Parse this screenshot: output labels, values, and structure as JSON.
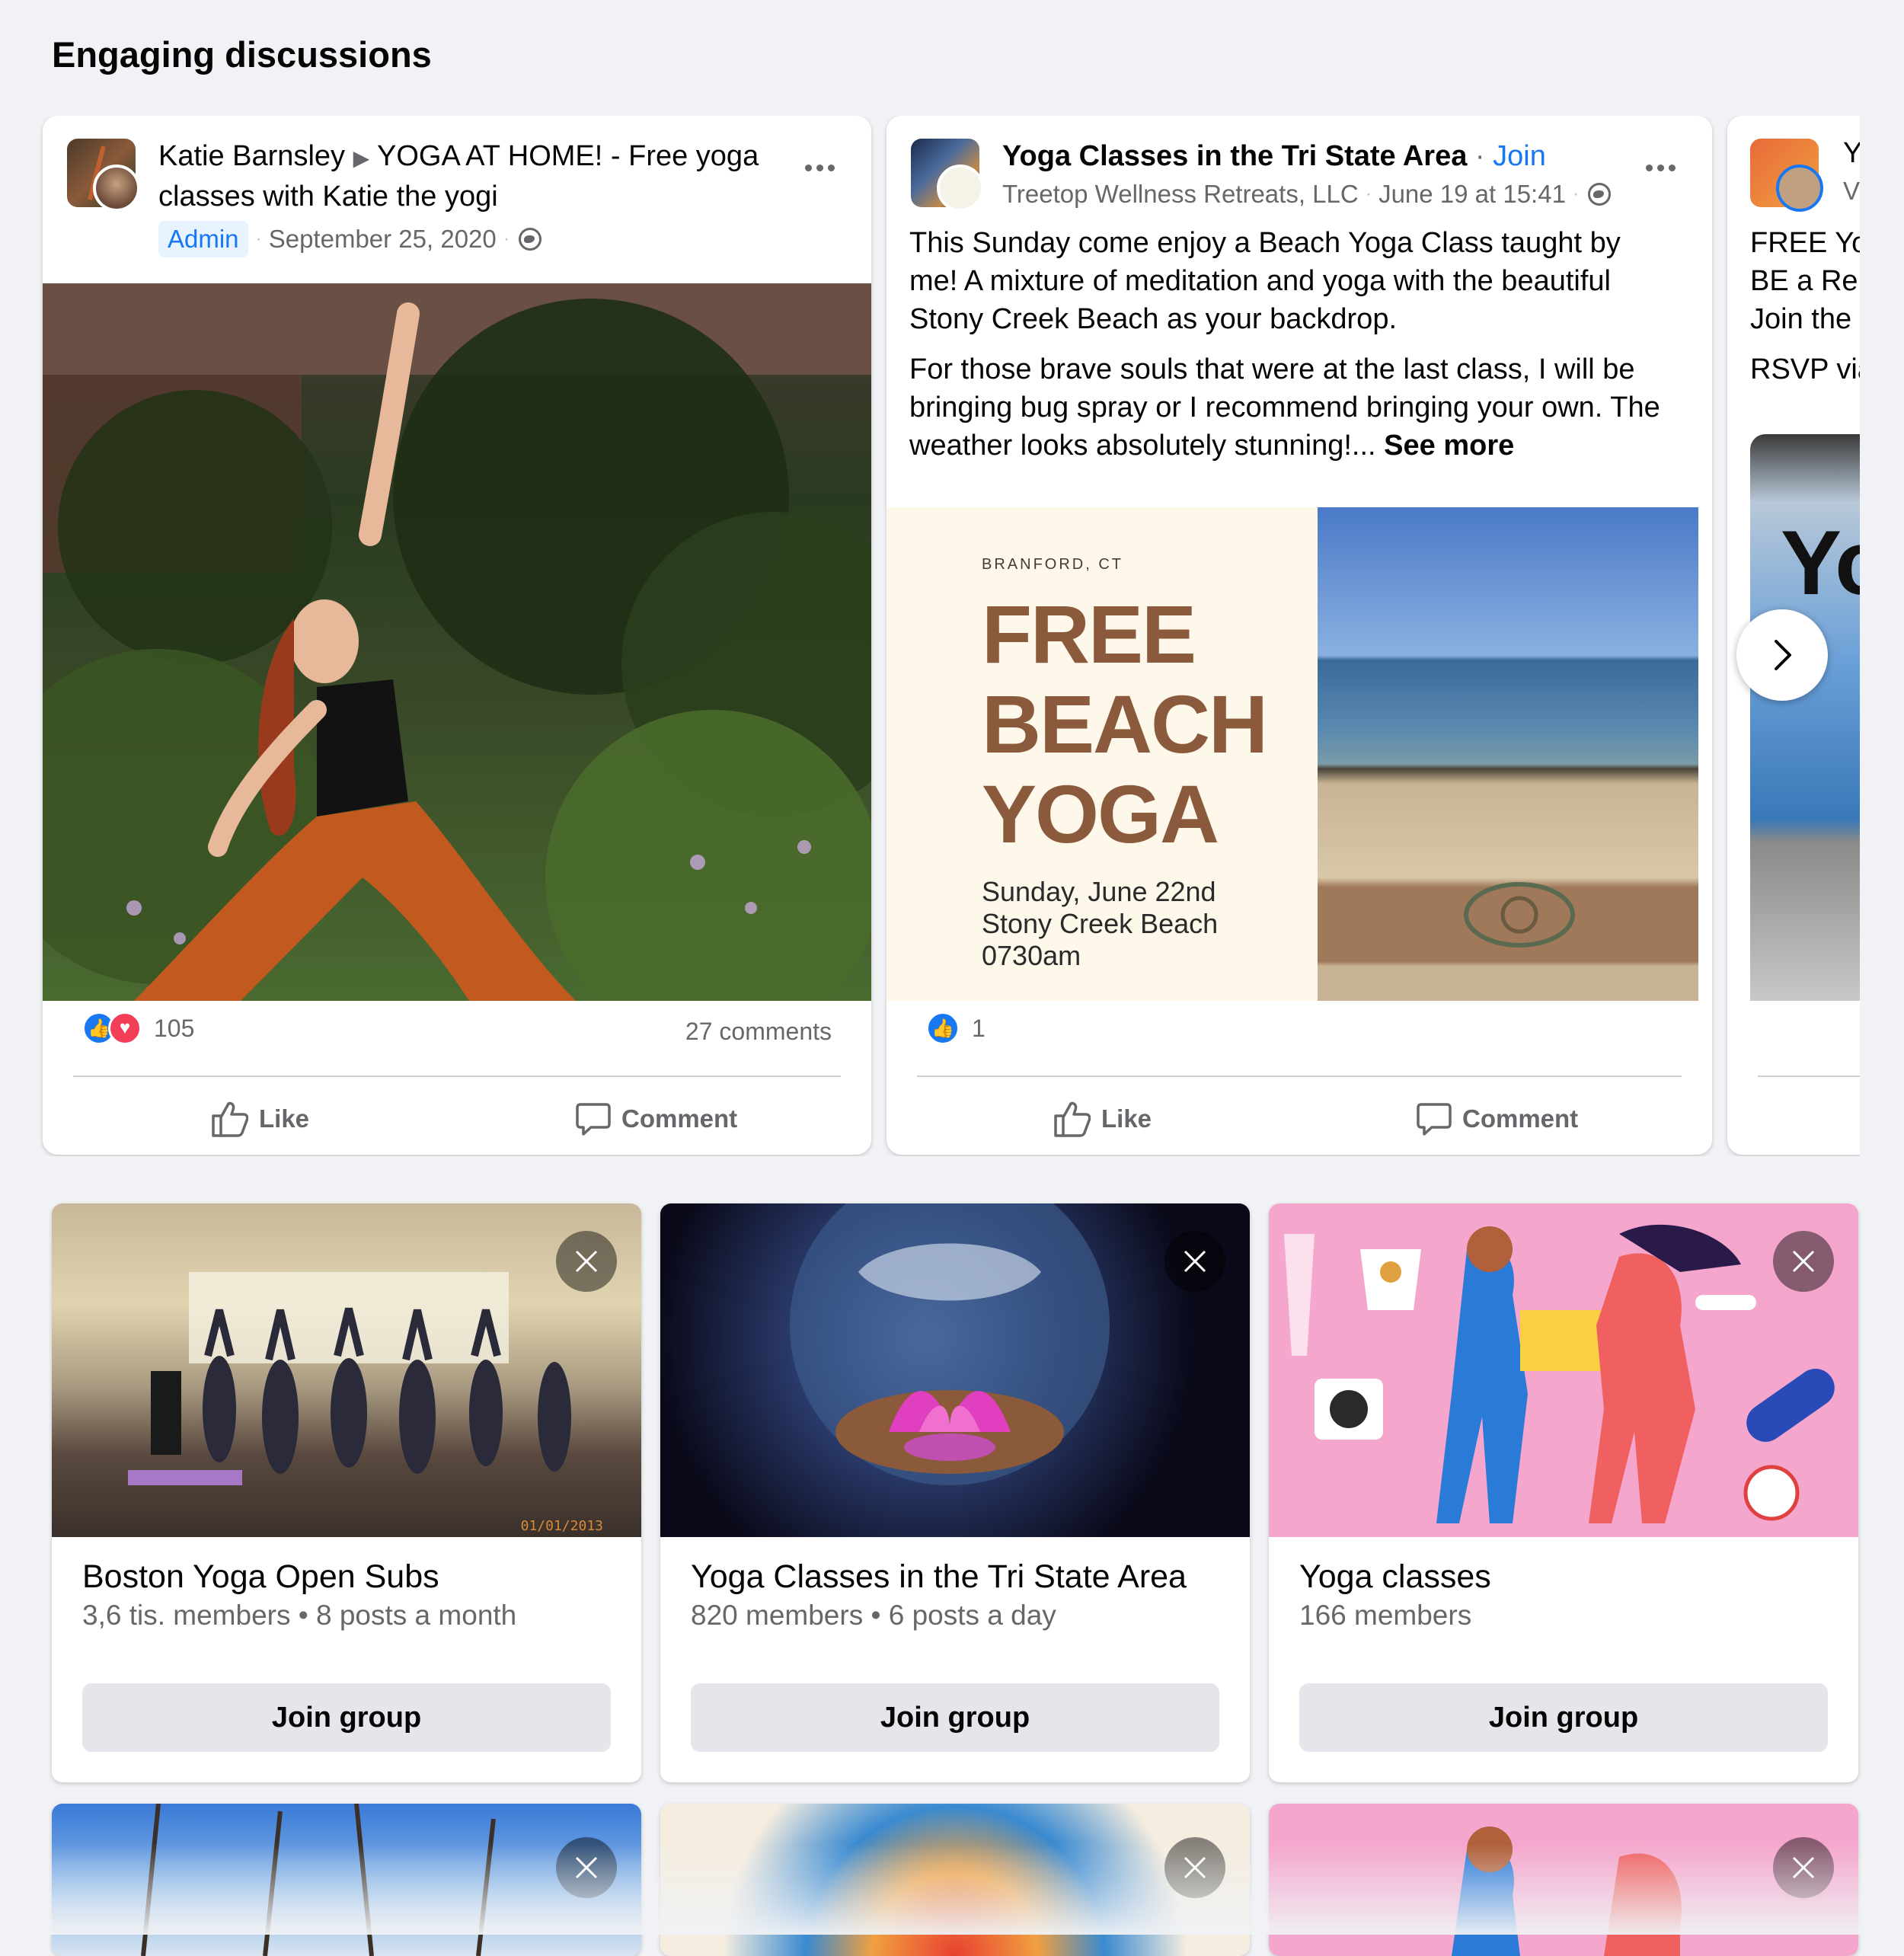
{
  "section_title": "Engaging discussions",
  "posts": [
    {
      "author": "Katie Barnsley",
      "group": "YOGA AT HOME! - Free yoga classes with Katie the yogi",
      "badge": "Admin",
      "date": "September 25, 2020",
      "reactions_count": "105",
      "comments_count": "27 comments",
      "like_label": "Like",
      "comment_label": "Comment"
    },
    {
      "group": "Yoga Classes in the Tri State Area",
      "join_label": "Join",
      "author": "Treetop Wellness Retreats, LLC",
      "date": "June 19 at 15:41",
      "text_p1": "This Sunday come enjoy a Beach Yoga Class taught by me! A mixture of meditation and yoga with the beautiful Stony Creek Beach as your backdrop.",
      "text_p2": "For those brave souls that were at the last class, I will be bringing bug spray or I recommend bringing your own. The weather looks absolutely stunning!...",
      "see_more": "See more",
      "poster": {
        "location": "BRANFORD, CT",
        "line1": "FREE",
        "line2": "BEACH",
        "line3": "YOGA",
        "date": "Sunday, June 22nd",
        "place": "Stony Creek Beach",
        "time": "0730am"
      },
      "reactions_count": "1",
      "like_label": "Like",
      "comment_label": "Comment"
    },
    {
      "title_fragment": "Y",
      "subtitle_fragment": "V",
      "text_l1": "FREE Yog",
      "text_l2": "BE a Reb",
      "text_l3": "Join the",
      "text_l4": "RSVP via",
      "image_text": "Yo"
    }
  ],
  "groups": [
    {
      "name": "Boston Yoga Open Subs",
      "meta": "3,6 tis. members • 8 posts a month",
      "join_label": "Join group",
      "image_stamp": "01/01/2013"
    },
    {
      "name": "Yoga Classes in the Tri State Area",
      "meta": "820 members • 6 posts a day",
      "join_label": "Join group"
    },
    {
      "name": "Yoga classes",
      "meta": "166 members",
      "join_label": "Join group"
    }
  ],
  "colors": {
    "brand_blue": "#1877f2",
    "love_red": "#f33e58",
    "poster_brown": "#8b5a3c",
    "background": "#f0f2f5"
  }
}
